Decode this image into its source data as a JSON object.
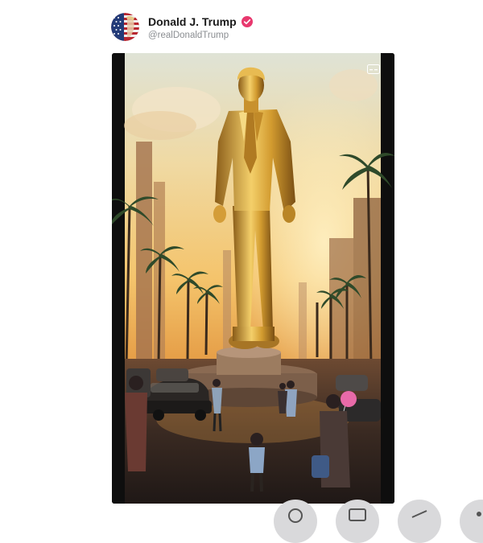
{
  "post": {
    "author": {
      "display_name": "Donald J. Trump",
      "handle": "@realDonaldTrump",
      "verified_badge_color": "#e8386e",
      "avatar_icon": "american-flag-avatar-icon"
    },
    "media": {
      "kind": "video",
      "corner_icon": "caption-icon"
    }
  },
  "bottom_controls": [
    "control-icon",
    "control-icon",
    "control-icon",
    "control-icon"
  ],
  "colors": {
    "background": "#ffffff",
    "name_text": "#1a1a1a",
    "handle_text": "#8a8d91",
    "gold": "#d8a93a",
    "sky_warm": "#f2c977"
  }
}
